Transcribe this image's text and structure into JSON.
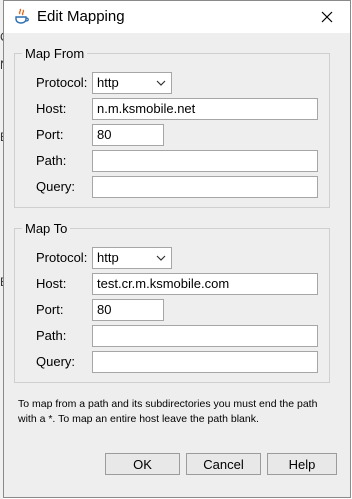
{
  "background": {
    "glyphs": [
      "C",
      "N",
      "E",
      "E"
    ]
  },
  "dialog": {
    "title": "Edit Mapping"
  },
  "map_from": {
    "legend": "Map From",
    "protocol_label": "Protocol:",
    "protocol_value": "http",
    "host_label": "Host:",
    "host_value": "n.m.ksmobile.net",
    "port_label": "Port:",
    "port_value": "80",
    "path_label": "Path:",
    "path_value": "",
    "query_label": "Query:",
    "query_value": ""
  },
  "map_to": {
    "legend": "Map To",
    "protocol_label": "Protocol:",
    "protocol_value": "http",
    "host_label": "Host:",
    "host_value": "test.cr.m.ksmobile.com",
    "port_label": "Port:",
    "port_value": "80",
    "path_label": "Path:",
    "path_value": "",
    "query_label": "Query:",
    "query_value": ""
  },
  "note": "To map from a path and its subdirectories you must end the path with a *. To map an entire host leave the path blank.",
  "buttons": {
    "ok": "OK",
    "cancel": "Cancel",
    "help": "Help"
  }
}
